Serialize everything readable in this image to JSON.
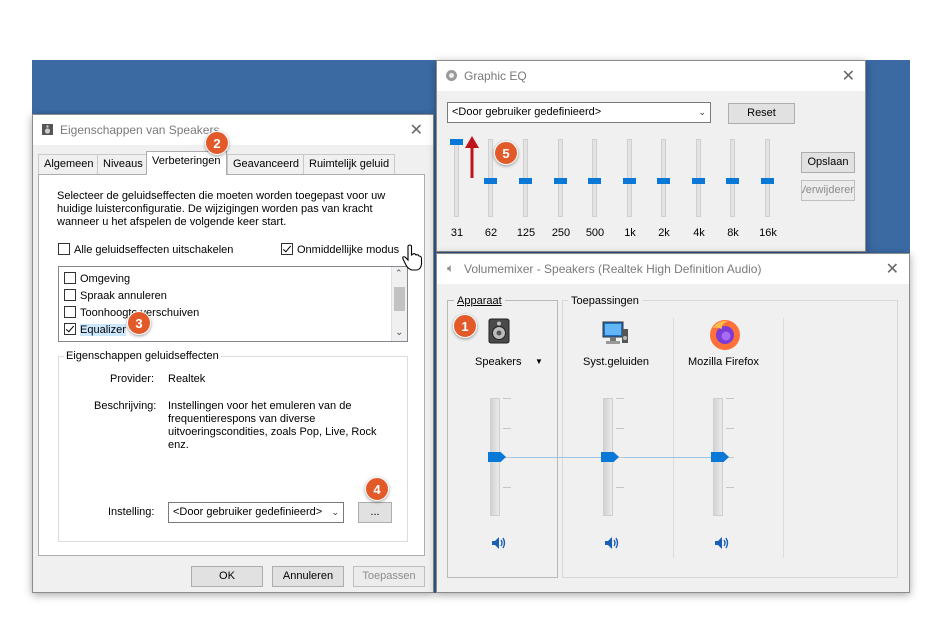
{
  "colors": {
    "desktop": "#3b6aa3",
    "accent": "#0a78d7",
    "badge": "#e35a2a",
    "arrow": "#c0151c"
  },
  "speakers_window": {
    "title": "Eigenschappen van Speakers",
    "tabs": [
      "Algemeen",
      "Niveaus",
      "Verbeteringen",
      "Geavanceerd",
      "Ruimtelijk geluid"
    ],
    "active_tab": "Verbeteringen",
    "description": "Selecteer de geluidseffecten die moeten worden toegepast voor uw huidige luisterconfiguratie. De wijzigingen worden pas van kracht wanneer u het afspelen de volgende keer start.",
    "disable_all_label": "Alle geluidseffecten uitschakelen",
    "immediate_mode_label": "Onmiddellijke modus",
    "immediate_mode_checked": true,
    "effects": [
      {
        "label": "Omgeving",
        "checked": false
      },
      {
        "label": "Spraak annuleren",
        "checked": false
      },
      {
        "label": "Toonhoogte verschuiven",
        "checked": false
      },
      {
        "label": "Equalizer",
        "checked": true
      }
    ],
    "group_title": "Eigenschappen geluidseffecten",
    "provider_label": "Provider:",
    "provider_value": "Realtek",
    "description_label": "Beschrijving:",
    "description_value": "Instellingen voor het emuleren van de frequentierespons van diverse uitvoeringscondities, zoals Pop, Live, Rock enz.",
    "setting_label": "Instelling:",
    "setting_value": "<Door gebruiker gedefinieerd>",
    "more_button": "...",
    "ok_button": "OK",
    "cancel_button": "Annuleren",
    "apply_button": "Toepassen"
  },
  "eq_window": {
    "title": "Graphic EQ",
    "preset_value": "<Door gebruiker gedefinieerd>",
    "reset_button": "Reset",
    "save_button": "Opslaan",
    "remove_button": "Verwijderen",
    "bands": [
      {
        "label": "31",
        "level": 1.0
      },
      {
        "label": "62",
        "level": 0.5
      },
      {
        "label": "125",
        "level": 0.5
      },
      {
        "label": "250",
        "level": 0.5
      },
      {
        "label": "500",
        "level": 0.5
      },
      {
        "label": "1k",
        "level": 0.5
      },
      {
        "label": "2k",
        "level": 0.5
      },
      {
        "label": "4k",
        "level": 0.5
      },
      {
        "label": "8k",
        "level": 0.5
      },
      {
        "label": "16k",
        "level": 0.5
      }
    ]
  },
  "mixer_window": {
    "title": "Volumemixer - Speakers (Realtek High Definition Audio)",
    "device_header": "Apparaat",
    "apps_header": "Toepassingen",
    "channels": [
      {
        "name": "Speakers",
        "icon": "speaker-device-icon",
        "level": 0.5,
        "has_dropdown": true
      },
      {
        "name": "Syst.geluiden",
        "icon": "system-sounds-icon",
        "level": 0.5,
        "has_dropdown": false
      },
      {
        "name": "Mozilla Firefox",
        "icon": "firefox-icon",
        "level": 0.5,
        "has_dropdown": false
      }
    ]
  },
  "badges": [
    "1",
    "2",
    "3",
    "4",
    "5"
  ]
}
